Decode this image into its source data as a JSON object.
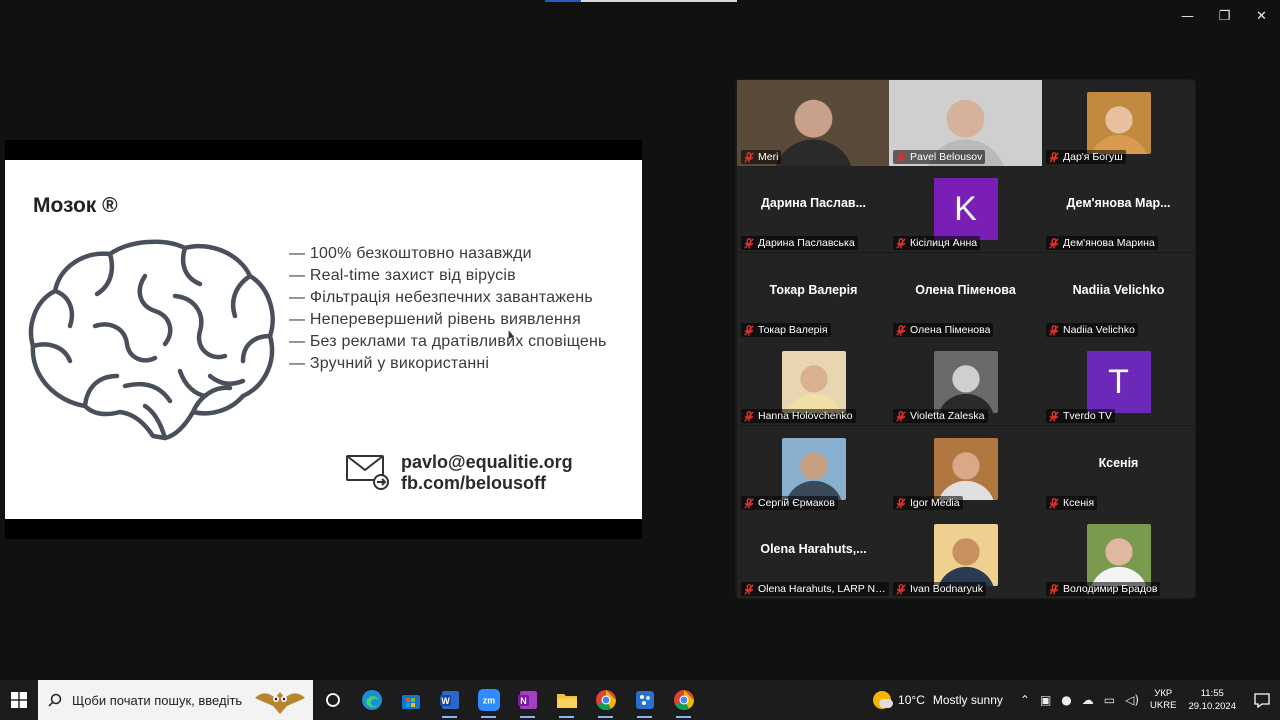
{
  "window": {
    "minimize": "—",
    "restore": "❐",
    "close": "✕"
  },
  "slide": {
    "title": "Мозок ®",
    "bullets": [
      "— 100% безкоштовно назавжди",
      "— Real-time захист від вірусів",
      "— Фільтрація небезпечних завантажень",
      "— Неперевершений рівень виявлення",
      "— Без реклами та дратівливих сповіщень",
      "— Зручний у використанні"
    ],
    "email": "pavlo@equalitie.org",
    "facebook": "fb.com/belousoff"
  },
  "gallery": {
    "tiles": [
      {
        "name": "Meri",
        "kind": "video"
      },
      {
        "name": "Pavel Belousov",
        "kind": "video",
        "active": true
      },
      {
        "name": "Дар'я Богуш",
        "kind": "photo"
      },
      {
        "name": "Дарина Паславська",
        "display": "Дарина  Паслав...",
        "kind": "name"
      },
      {
        "name": "Кісiлиця Анна",
        "kind": "letter",
        "letter": "K",
        "color": "#7a1fb5"
      },
      {
        "name": "Дем'янова Марина",
        "display": "Дем'янова  Мар...",
        "kind": "name"
      },
      {
        "name": "Токар Валерія",
        "display": "Токар Валерія",
        "kind": "name"
      },
      {
        "name": "Олена Піменова",
        "display": "Олена Піменова",
        "kind": "name"
      },
      {
        "name": "Nadiia Velichko",
        "display": "Nadiia Velichko",
        "kind": "name"
      },
      {
        "name": "Hanna Holovchenko",
        "kind": "photo"
      },
      {
        "name": "Violetta Zaleska",
        "kind": "photo"
      },
      {
        "name": "Tverdo TV",
        "kind": "letter",
        "letter": "T",
        "color": "#6c28b8"
      },
      {
        "name": "Сергій Єрмаков",
        "kind": "photo"
      },
      {
        "name": "Igor Media",
        "kind": "photo"
      },
      {
        "name": "Ксенія",
        "display": "Ксенія",
        "kind": "name"
      },
      {
        "name": "Olena Harahuts, LARP NGO",
        "display": "Olena  Harahuts,...",
        "kind": "name"
      },
      {
        "name": "Ivan Bodnaryuk",
        "kind": "photo"
      },
      {
        "name": "Володимир Брадов",
        "kind": "photo"
      }
    ]
  },
  "taskbar": {
    "search_placeholder": "Щоби почати пошук, введіть",
    "apps": [
      "task-view",
      "edge",
      "store",
      "word",
      "zoom",
      "onenote",
      "file-explorer",
      "chrome",
      "app-blue",
      "chrome-profile"
    ],
    "weather_temp": "10°C",
    "weather_text": "Mostly sunny",
    "lang_1": "УКР",
    "lang_2": "UKRE",
    "time": "11:55",
    "date": "29.10.2024"
  }
}
